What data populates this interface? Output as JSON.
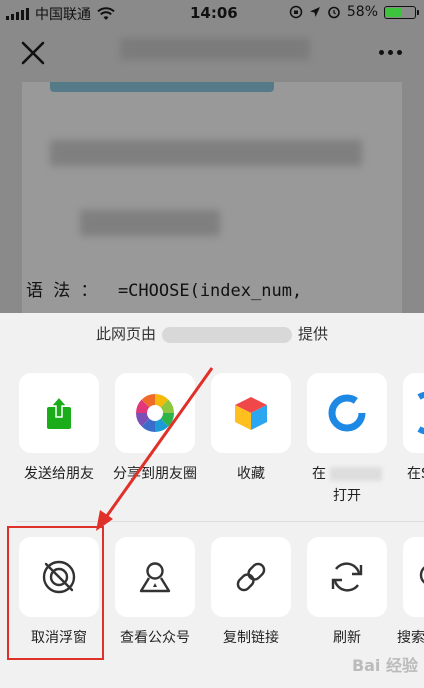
{
  "status_bar": {
    "carrier": "中国联通",
    "time": "14:06",
    "battery": "58%",
    "battery_level": 0.58
  },
  "nav": {
    "close_icon": "close-icon",
    "more_icon": "more-icon"
  },
  "article": {
    "syntax_line": "语 法 ：  =CHOOSE(index_num,"
  },
  "share_sheet": {
    "title_prefix": "此网页由",
    "title_suffix": "提供",
    "row1": [
      {
        "label": "发送给朋友",
        "icon": "send-to-friend-icon"
      },
      {
        "label": "分享到朋友圈",
        "icon": "moments-icon"
      },
      {
        "label": "收藏",
        "icon": "favorites-icon"
      },
      {
        "label": "在",
        "label2": "打开",
        "icon": "browser-icon"
      },
      {
        "label": "在S",
        "icon": "more-app-icon"
      }
    ],
    "row2": [
      {
        "label": "取消浮窗",
        "icon": "cancel-float-icon"
      },
      {
        "label": "查看公众号",
        "icon": "official-account-icon"
      },
      {
        "label": "复制链接",
        "icon": "link-icon"
      },
      {
        "label": "刷新",
        "icon": "refresh-icon"
      },
      {
        "label": "搜索",
        "icon": "search-icon"
      }
    ]
  },
  "watermark": "Bai 经验",
  "colors": {
    "accent_red": "#e0302a",
    "battery_green": "#3cc43c",
    "sheet_bg": "#f1f1f1"
  }
}
